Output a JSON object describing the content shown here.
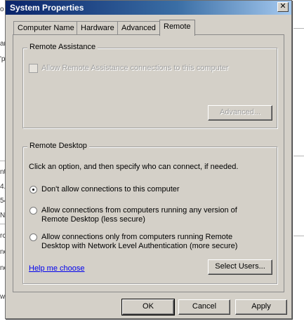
{
  "background": {
    "fragments": [
      "o",
      "ar",
      "'p",
      "nt",
      "4.(",
      "54",
      "No",
      "rc",
      "ne",
      "ne",
      "w("
    ]
  },
  "dialog": {
    "title": "System Properties",
    "close_glyph": "✕"
  },
  "tabs": [
    {
      "label": "Computer Name",
      "active": false
    },
    {
      "label": "Hardware",
      "active": false
    },
    {
      "label": "Advanced",
      "active": false
    },
    {
      "label": "Remote",
      "active": true
    }
  ],
  "remote_assistance": {
    "legend": "Remote Assistance",
    "checkbox_label": "Allow Remote Assistance connections to this computer",
    "checked": false,
    "enabled": false,
    "advanced_button": "Advanced..."
  },
  "remote_desktop": {
    "legend": "Remote Desktop",
    "instruction": "Click an option, and then specify who can connect, if needed.",
    "options": [
      {
        "line1": "Don't allow connections to this computer",
        "line2": "",
        "selected": true
      },
      {
        "line1": "Allow connections from computers running any version of",
        "line2": "Remote Desktop (less secure)",
        "selected": false
      },
      {
        "line1": "Allow connections only from computers running Remote",
        "line2": "Desktop with Network Level Authentication (more secure)",
        "selected": false
      }
    ],
    "help_link": "Help me choose",
    "select_users_button": "Select Users..."
  },
  "footer": {
    "ok": "OK",
    "cancel": "Cancel",
    "apply": "Apply"
  }
}
